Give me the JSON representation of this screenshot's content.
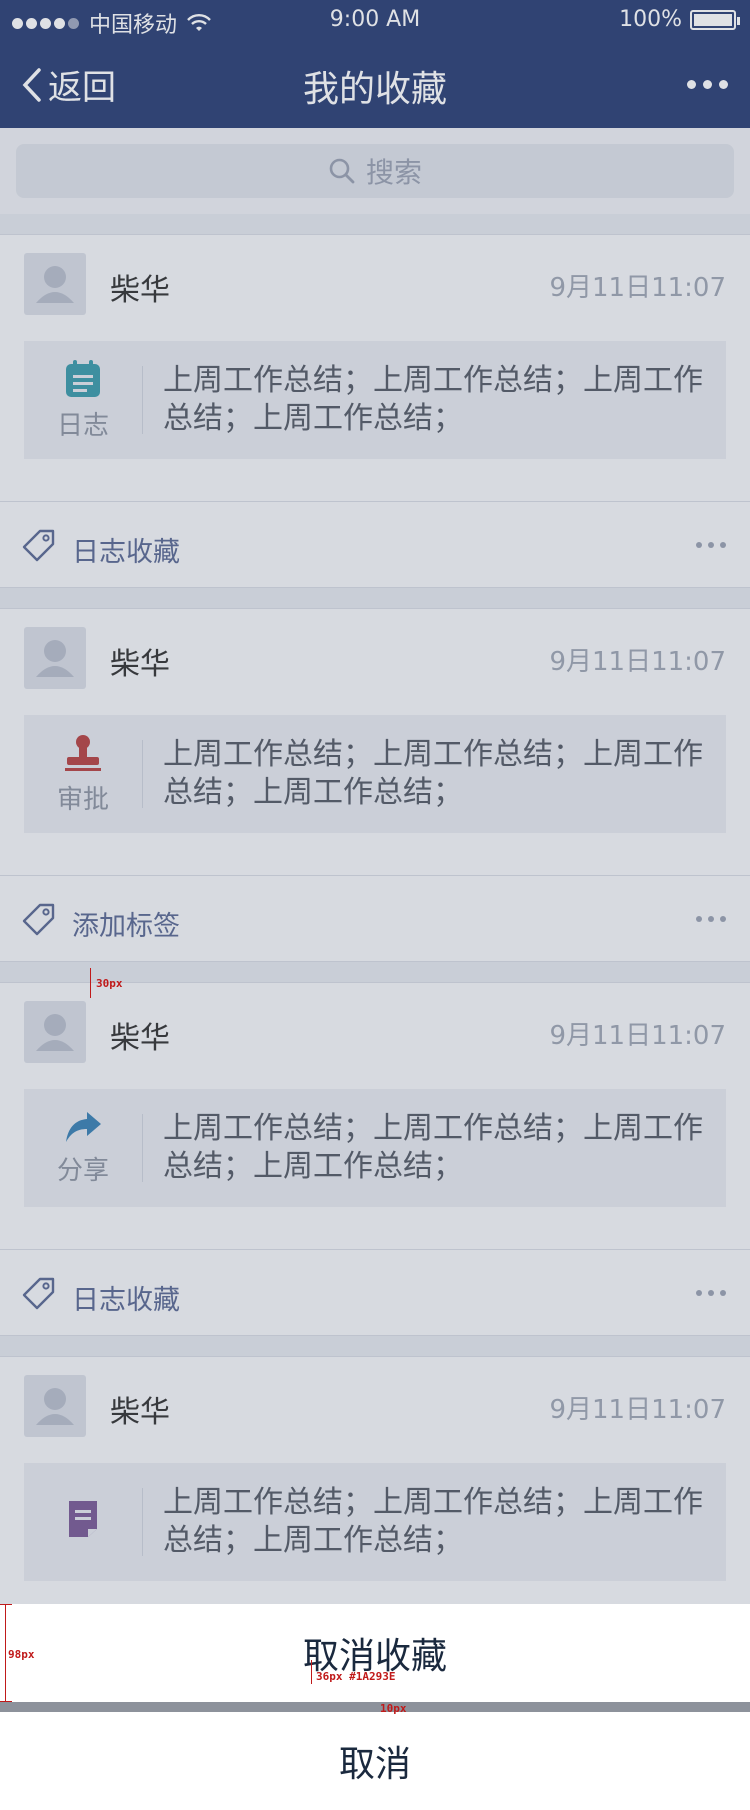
{
  "status_bar": {
    "carrier": "中国移动",
    "time": "9:00 AM",
    "battery": "100%",
    "icons": [
      "signal-dots-icon",
      "wifi-icon",
      "battery-icon"
    ]
  },
  "nav": {
    "back_label": "返回",
    "title": "我的收藏",
    "more_icon": "more-icon"
  },
  "search": {
    "placeholder": "搜索"
  },
  "cards": [
    {
      "author": "柴华",
      "time": "9月11日11:07",
      "type_label": "日志",
      "type_icon": "notebook-icon",
      "text": "上周工作总结；上周工作总结；上周工作总结；上周工作总结；",
      "tag_label": "日志收藏"
    },
    {
      "author": "柴华",
      "time": "9月11日11:07",
      "type_label": "审批",
      "type_icon": "stamp-icon",
      "text": "上周工作总结；上周工作总结；上周工作总结；上周工作总结；",
      "tag_label": "添加标签"
    },
    {
      "author": "柴华",
      "time": "9月11日11:07",
      "type_label": "分享",
      "type_icon": "share-arrow-icon",
      "text": "上周工作总结；上周工作总结；上周工作总结；上周工作总结；",
      "tag_label": "日志收藏"
    },
    {
      "author": "柴华",
      "time": "9月11日11:07",
      "type_label": "",
      "type_icon": "document-icon",
      "text": "上周工作总结；上周工作总结；上周工作总结；上周工作总结；",
      "tag_label": ""
    }
  ],
  "action_sheet": {
    "confirm_label": "取消收藏",
    "cancel_label": "取消"
  },
  "annotations": {
    "gap_30": "30px",
    "height_98": "98px",
    "font_spec": "36px #1A293E",
    "gap_10": "10px"
  },
  "colors": {
    "nav_bg": "#2a3f74",
    "sheet_text": "#1A293E",
    "tag_text": "#5b6a94",
    "annotation": "#c01a1a"
  }
}
